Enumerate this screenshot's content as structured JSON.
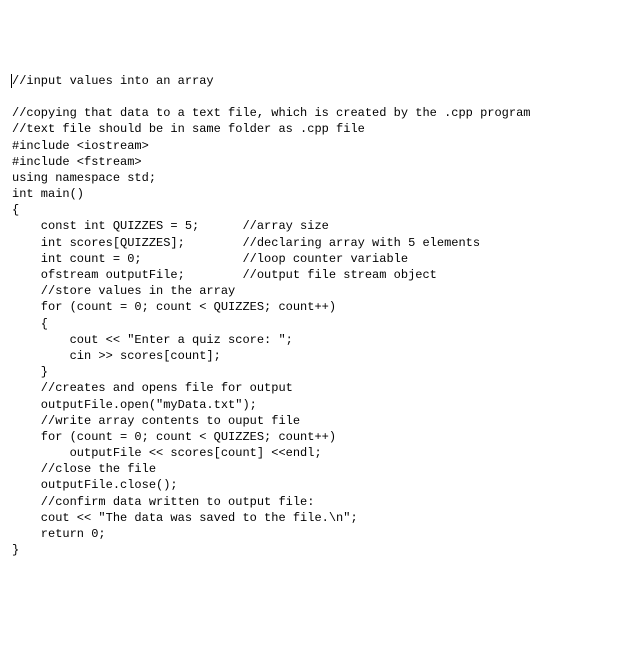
{
  "code": {
    "lines": [
      "//input values into an array",
      "//copying that data to a text file, which is created by the .cpp program",
      "//text file should be in same folder as .cpp file",
      "",
      "#include <iostream>",
      "#include <fstream>",
      "using namespace std;",
      "",
      "int main()",
      "{",
      "    const int QUIZZES = 5;      //array size",
      "    int scores[QUIZZES];        //declaring array with 5 elements",
      "    int count = 0;              //loop counter variable",
      "    ofstream outputFile;        //output file stream object",
      "",
      "    //store values in the array",
      "    for (count = 0; count < QUIZZES; count++)",
      "    {",
      "        cout << \"Enter a quiz score: \";",
      "        cin >> scores[count];",
      "    }",
      "    //creates and opens file for output",
      "    outputFile.open(\"myData.txt\");",
      "",
      "    //write array contents to ouput file",
      "    for (count = 0; count < QUIZZES; count++)",
      "        outputFile << scores[count] <<endl;",
      "",
      "    //close the file",
      "    outputFile.close();",
      "",
      "    //confirm data written to output file:",
      "    cout << \"The data was saved to the file.\\n\";",
      "",
      "    return 0;",
      "}"
    ]
  }
}
